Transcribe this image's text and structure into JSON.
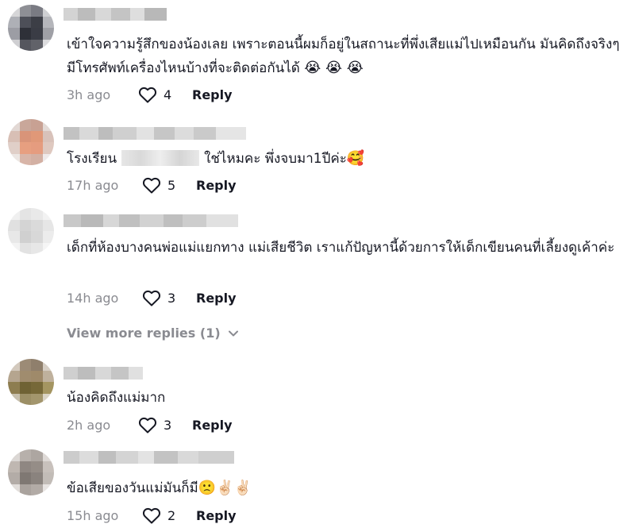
{
  "comments": [
    {
      "text": "เข้าใจความรู้สึกของน้องเลย เพราะตอนนี้ผมก็อยู่ในสถานะที่พึ่งเสียแม่ไปเหมือนกัน มันคิดถึงจริงๆ มีโทรศัพท์เครื่องไหนบ้างที่จะติดต่อกันได้",
      "emoji": "😭 😭 😭",
      "time": "3h ago",
      "likes": "4",
      "reply": "Reply"
    },
    {
      "text_before": "โรงเรียน",
      "text_after": "ใช่ไหมคะ พึ่งจบมา1ปีค่ะ",
      "emoji": "🥰",
      "time": "17h ago",
      "likes": "5",
      "reply": "Reply"
    },
    {
      "text": "เด็กที่ห้องบางคนพ่อแม่แยกทาง แม่เสียชีวิต เราแก้ปัญหานี้ด้วยการให้เด็กเขียนคนที่เลี้ยงดูเค้าค่ะ",
      "time": "14h ago",
      "likes": "3",
      "reply": "Reply"
    },
    {
      "text": "น้องคิดถึงแม่มาก",
      "time": "2h ago",
      "likes": "3",
      "reply": "Reply"
    },
    {
      "text": "ข้อเสียของวันแม่มันก็มี",
      "emoji": "🙁✌🏻✌🏻",
      "time": "15h ago",
      "likes": "2",
      "reply": "Reply"
    }
  ],
  "view_more": "View more replies (1)",
  "icons": {
    "like": "heart-outline-icon",
    "expand": "chevron-down-icon"
  },
  "colors": {
    "text": "#161823",
    "muted": "#8a8b91"
  }
}
